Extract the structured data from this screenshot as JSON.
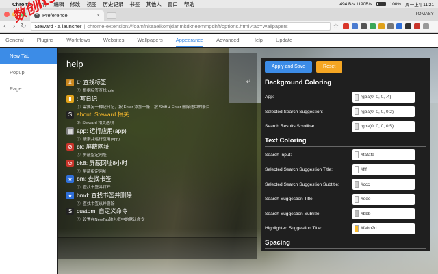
{
  "menubar": {
    "apple": "",
    "app": "Chrome",
    "items": [
      "文件",
      "编辑",
      "修改",
      "视图",
      "历史记录",
      "书签",
      "其他人",
      "窗口",
      "帮助"
    ],
    "net": "494 B/s 1190B/s",
    "battery": "100%",
    "clock": "周一上午11:21"
  },
  "tab": {
    "title": "Preference",
    "close": "×",
    "favicon": "S"
  },
  "profile": "TOMASY",
  "toolbar": {
    "omnibox_ext": "Steward - a",
    "omnibox_ext_rest": " launcher",
    "omnibox_sep": "|",
    "omnibox_url": "chrome-extension://foamfnkeaelkomjdanmkdkneemmgdhff/options.html?tab=Wallpapers",
    "star": "☆"
  },
  "nav": {
    "tabs": [
      "General",
      "Plugins",
      "Workflows",
      "Websites",
      "Wallpapers",
      "Appearance",
      "Advanced",
      "Help",
      "Update"
    ],
    "active": "Appearance"
  },
  "sidebar": {
    "items": [
      "New Tab",
      "Popup",
      "Page"
    ],
    "active": "New Tab"
  },
  "wordmark": "数创Itscs66",
  "help": {
    "title": "help",
    "return_glyph": "↵",
    "items": [
      {
        "icon": "tag-icon",
        "glyph": "#",
        "bg": "#c9871f",
        "title": "#: 查找标签",
        "desc": "①: 根据标签查找note",
        "hl": false
      },
      {
        "icon": "notebook-icon",
        "glyph": "▮",
        "bg": "#e0a21a",
        "title": ": 写日记",
        "desc": "①: 需要另一种记日记，按 Enter 添加一条，按 Shift + Enter 删除选中的条目",
        "hl": false
      },
      {
        "icon": "steward-icon",
        "glyph": "S",
        "bg": "#222222",
        "title": "about: Steward 相关",
        "desc": "①: Steward 相关选项",
        "hl": true
      },
      {
        "icon": "apps-grid-icon",
        "glyph": "▦",
        "bg": "#7d7d7d",
        "title": "app: 运行应用(app)",
        "desc": "①: 搜索并运行应用(app)",
        "hl": false
      },
      {
        "icon": "block-icon",
        "glyph": "⊘",
        "bg": "#c8342a",
        "title": "bk: 屏蔽网址",
        "desc": "①: 屏蔽指定网址",
        "hl": false
      },
      {
        "icon": "block-timer-icon",
        "glyph": "⊘",
        "bg": "#c8342a",
        "title": "bk8: 屏蔽网址8小时",
        "desc": "①: 屏蔽指定网址",
        "hl": false
      },
      {
        "icon": "bookmark-star-icon",
        "glyph": "★",
        "bg": "#2f6fd8",
        "title": "bm: 查找书签",
        "desc": "①: 查找书签并打开",
        "hl": false
      },
      {
        "icon": "bookmark-delete-icon",
        "glyph": "★",
        "bg": "#2f6fd8",
        "title": "bmd: 查找书签并删除",
        "desc": "①: 查找书签以并删除",
        "hl": false
      },
      {
        "icon": "custom-command-icon",
        "glyph": "S",
        "bg": "#222222",
        "title": "custom: 自定义命令",
        "desc": "①: 设置在NewTab输入框中的默认命令",
        "hl": false
      }
    ]
  },
  "search": {
    "value": ""
  },
  "settings": {
    "apply_label": "Apply and Save",
    "reset_label": "Reset",
    "bg_section": "Background Coloring",
    "bg_rows": [
      {
        "label": "App:",
        "value": "rgba(0, 0, 0, .4)",
        "swatch": "#e8e8e8"
      },
      {
        "label": "Selected Search Suggestion:",
        "value": "rgba(0, 0, 0, 0.2)",
        "swatch": "#eeeeee"
      },
      {
        "label": "Search Results Scrollbar:",
        "value": "rgba(0, 0, 0, 0.5)",
        "swatch": "#dddddd"
      }
    ],
    "text_section": "Text Coloring",
    "text_rows": [
      {
        "label": "Search Input:",
        "value": "#fafafa",
        "swatch": "#fafafa"
      },
      {
        "label": "Selected Search Suggestion Title:",
        "value": "#fff",
        "swatch": "#ffffff"
      },
      {
        "label": "Selected Search Suggestion Subtitle:",
        "value": "#ccc",
        "swatch": "#cccccc"
      },
      {
        "label": "Search Suggestion Title:",
        "value": "#eee",
        "swatch": "#eeeeee"
      },
      {
        "label": "Search Suggestion Subtitle:",
        "value": "#bbb",
        "swatch": "#bbbbbb"
      },
      {
        "label": "Highlighted Suggestion Title:",
        "value": "#fabb2d",
        "swatch": "#fabb2d"
      }
    ],
    "spacing_section": "Spacing"
  }
}
